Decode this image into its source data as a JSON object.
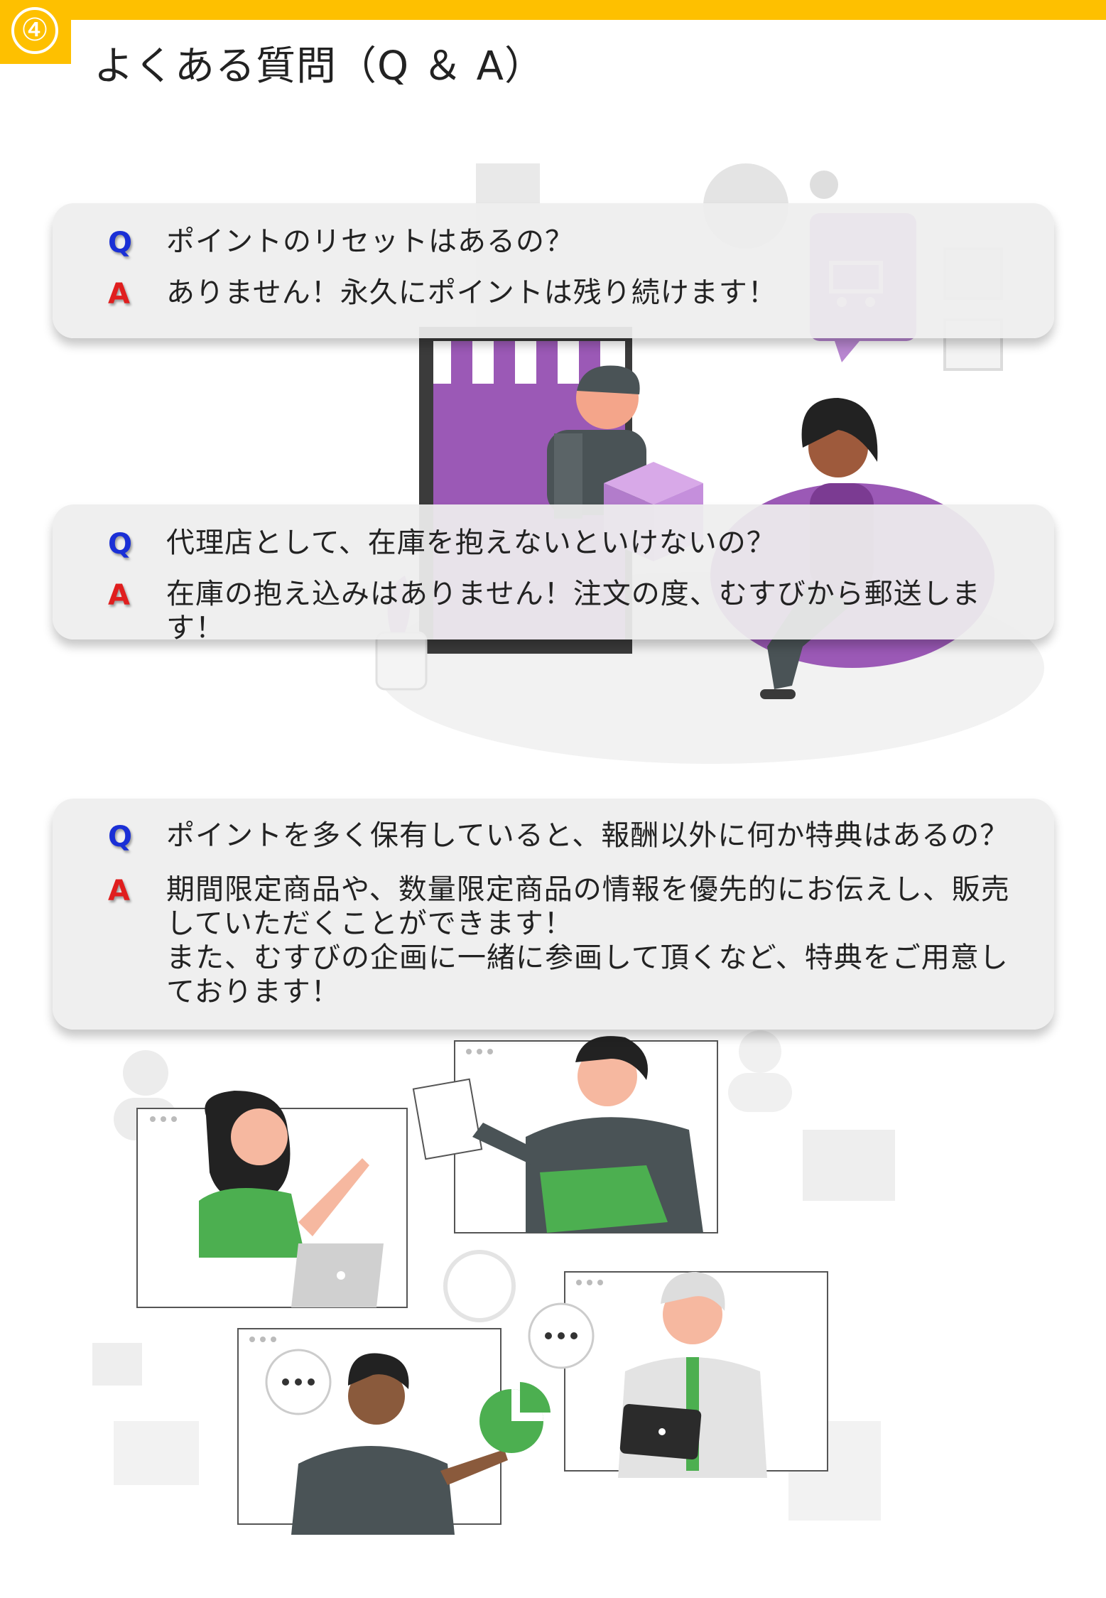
{
  "header": {
    "number": "④",
    "title": "よくある質問（Q ＆ A）"
  },
  "colors": {
    "accent": "#FEC000",
    "q_mark": "#1a2fd6",
    "a_mark": "#e01e1e",
    "illustration_purple": "#9B59B6",
    "illustration_green": "#4CAF50"
  },
  "faq": [
    {
      "q_mark": "Q",
      "question": "ポイントのリセットはあるの？",
      "a_mark": "A",
      "answer_lines": [
        "ありません！永久にポイントは残り続けます！"
      ]
    },
    {
      "q_mark": "Q",
      "question": "代理店として、在庫を抱えないといけないの？",
      "a_mark": "A",
      "answer_lines": [
        "在庫の抱え込みはありません！注文の度、むすびから郵送します！"
      ]
    },
    {
      "q_mark": "Q",
      "question": "ポイントを多く保有していると、報酬以外に何か特典はあるの？",
      "a_mark": "A",
      "answer_lines": [
        "期間限定商品や、数量限定商品の情報を優先的にお伝えし、販売",
        "していただくことができます！",
        "また、むすびの企画に一緒に参画して頂くなど、特典をご用意し",
        "ております！"
      ]
    }
  ],
  "illustrations": {
    "top": "online-shop-delivery-illustration",
    "bottom": "video-conference-team-illustration"
  }
}
